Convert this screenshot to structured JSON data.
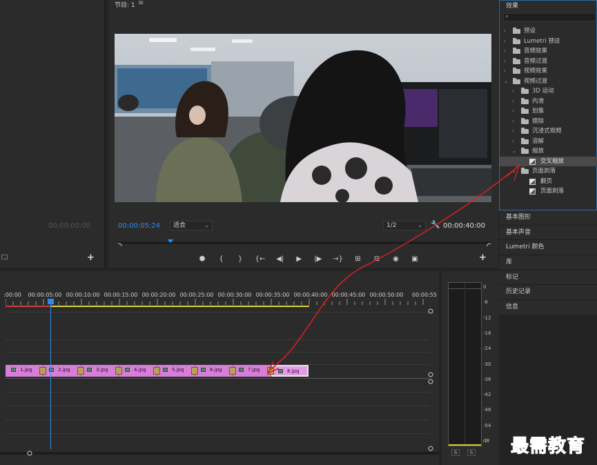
{
  "source": {
    "timecode": "00;00;00;00"
  },
  "program": {
    "title": "节目: 1",
    "menu_icon": "≡",
    "current_timecode": "00:00:05:24",
    "zoom": "适合",
    "resolution": "1/2",
    "duration_timecode": "00:00:40:00"
  },
  "effects": {
    "title": "效果",
    "tree": [
      {
        "id": "presets",
        "label": "预设",
        "level": 0,
        "open": false,
        "kind": "folder-special"
      },
      {
        "id": "lumetri",
        "label": "Lumetri 预设",
        "level": 0,
        "open": false,
        "kind": "folder-special"
      },
      {
        "id": "audio-fx",
        "label": "音频效果",
        "level": 0,
        "open": false,
        "kind": "folder"
      },
      {
        "id": "audio-trans",
        "label": "音频过渡",
        "level": 0,
        "open": false,
        "kind": "folder"
      },
      {
        "id": "video-fx",
        "label": "视频效果",
        "level": 0,
        "open": false,
        "kind": "folder"
      },
      {
        "id": "video-trans",
        "label": "视频过渡",
        "level": 0,
        "open": true,
        "kind": "folder"
      },
      {
        "id": "3d",
        "label": "3D 运动",
        "level": 1,
        "open": false,
        "kind": "folder"
      },
      {
        "id": "slide",
        "label": "内滑",
        "level": 1,
        "open": false,
        "kind": "folder"
      },
      {
        "id": "iris",
        "label": "划像",
        "level": 1,
        "open": false,
        "kind": "folder"
      },
      {
        "id": "wipe",
        "label": "擦除",
        "level": 1,
        "open": false,
        "kind": "folder"
      },
      {
        "id": "immersive",
        "label": "沉浸式视频",
        "level": 1,
        "open": false,
        "kind": "folder"
      },
      {
        "id": "dissolve",
        "label": "溶解",
        "level": 1,
        "open": false,
        "kind": "folder"
      },
      {
        "id": "zoom",
        "label": "缩放",
        "level": 1,
        "open": true,
        "kind": "folder"
      },
      {
        "id": "cross-zoom",
        "label": "交叉缩放",
        "level": 2,
        "open": false,
        "kind": "effect",
        "selected": true
      },
      {
        "id": "page-peel",
        "label": "页面剥落",
        "level": 1,
        "open": true,
        "kind": "folder"
      },
      {
        "id": "page-turn",
        "label": "翻页",
        "level": 2,
        "open": false,
        "kind": "effect"
      },
      {
        "id": "page-peel-fx",
        "label": "页面剥落",
        "level": 2,
        "open": false,
        "kind": "effect"
      }
    ]
  },
  "side_tabs": [
    "基本图形",
    "基本声音",
    "Lumetri 颜色",
    "库",
    "标记",
    "历史记录",
    "信息"
  ],
  "timeline": {
    "ruler": [
      ":00:00",
      "00:00:05:00",
      "00:00:10:00",
      "00:00:15:00",
      "00:00:20:00",
      "00:00:25:00",
      "00:00:30:00",
      "00:00:35:00",
      "00:00:40:00",
      "00:00:45:00",
      "00:00:50:00",
      "00:00:55"
    ],
    "clips": [
      "1.jpg",
      "2.jpg",
      "3.jpg",
      "4.jpg",
      "5.jpg",
      "6.jpg",
      "7.jpg",
      "8.jpg"
    ]
  },
  "meter": {
    "labels": [
      "0",
      "-6",
      "-12",
      "-18",
      "-24",
      "-30",
      "-36",
      "-42",
      "-48",
      "-54",
      "dB"
    ],
    "solo": [
      "S",
      "S"
    ]
  },
  "watermark": "最需教育",
  "colors": {
    "accent": "#2d8ceb",
    "clip": "#d77ed9",
    "annotation": "#d42020"
  }
}
